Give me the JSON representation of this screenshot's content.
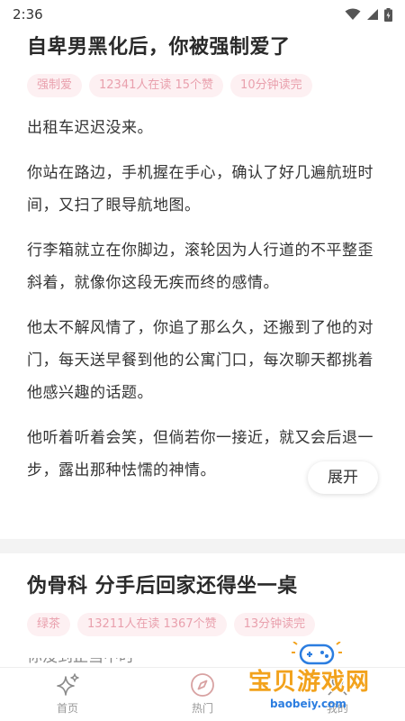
{
  "status_bar": {
    "time": "2:36"
  },
  "articles": [
    {
      "title": "自卑男黑化后，你被强制爱了",
      "tags": [
        "强制爱",
        "12341人在读 15个赞",
        "10分钟读完"
      ],
      "paragraphs": [
        "出租车迟迟没来。",
        "你站在路边，手机握在手心，确认了好几遍航班时间，又扫了眼导航地图。",
        "行李箱就立在你脚边，滚轮因为人行道的不平整歪斜着，就像你这段无疾而终的感情。",
        "他太不解风情了，你追了那么久，还搬到了他的对门，每天送早餐到他的公寓门口，每次聊天都挑着他感兴趣的话题。",
        "他听着听着会笑，但倘若你一接近，就又会后退一步，露出那种怯懦的神情。"
      ],
      "expand_label": "展开"
    },
    {
      "title": "伪骨科 分手后回家还得坐一桌",
      "tags": [
        "绿茶",
        "13211人在读 1367个赞",
        "13分钟读完"
      ],
      "peek_text": "你没到正当中时"
    }
  ],
  "tab_bar": {
    "items": [
      {
        "label": "首页",
        "icon": "sparkle-icon",
        "active": true
      },
      {
        "label": "热门",
        "icon": "compass-icon",
        "active": false
      },
      {
        "label": "我的",
        "icon": "person-icon",
        "active": false
      }
    ]
  },
  "watermark": {
    "text": "宝贝游戏网",
    "url": "baobeiy.com"
  },
  "colors": {
    "tag_bg": "#fdf0f2",
    "tag_text": "#e9a0ad",
    "title": "#2a2a2a",
    "body_text": "#333333",
    "separator": "#f3f3f3",
    "tab_inactive": "#999999",
    "watermark_orange": "#f2a21c",
    "watermark_blue": "#2b7de0"
  }
}
